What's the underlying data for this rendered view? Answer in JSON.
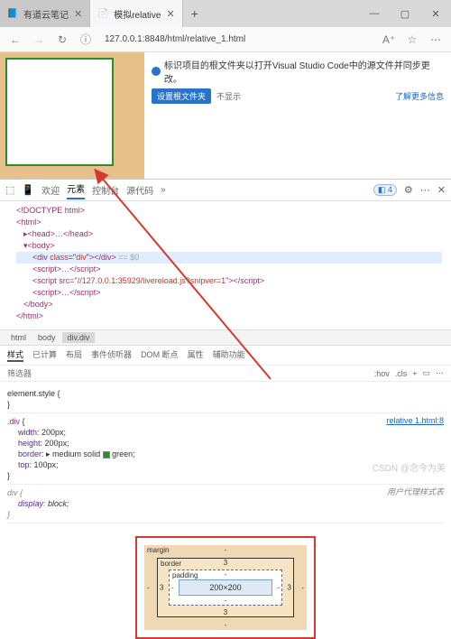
{
  "tabs": {
    "inactive_icon": "📘",
    "inactive_label": "有道云笔记",
    "active_icon": "📄",
    "active_label": "模拟relative",
    "new": "+"
  },
  "window": {
    "min": "—",
    "max": "▢",
    "close": "✕"
  },
  "nav": {
    "back": "←",
    "fwd": "→",
    "reload": "↻",
    "info": "ⓘ"
  },
  "url": "127.0.0.1:8848/html/relative_1.html",
  "toolbar_right": {
    "reader": "A⁺",
    "star": "☆",
    "menu": "⋯"
  },
  "notice": {
    "line1": "标识项目的根文件夹以打开Visual Studio Code中的源文件并同步更改。",
    "btn": "设置根文件夹",
    "skip": "不显示",
    "more": "了解更多信息"
  },
  "devtabs": {
    "pick": "⬚",
    "device": "📱",
    "t1": "欢迎",
    "t2": "元素",
    "t3": "控制台",
    "t4": "源代码",
    "more": "»",
    "issue_icon": "◧",
    "issue_n": "4",
    "gear": "⚙",
    "dots": "⋯",
    "x": "✕"
  },
  "source": {
    "l1": "<!DOCTYPE html>",
    "l2o": "<html>",
    "l3": "▸<head>…</head>",
    "l4": "▾<body>",
    "l5": "<div class=\"div\"></div>",
    "l5c": " == $0",
    "l6": "<script>…</script>",
    "l7a": "<script src=\"",
    "l7b": "//127.0.0.1:35929/livereload.js?snipver=1",
    "l7c": "\"></script>",
    "l8": "<script>…</script>",
    "l9": "</body>",
    "l10": "</html>"
  },
  "crumbs": {
    "c1": "html",
    "c2": "body",
    "c3": "div.div"
  },
  "stabs": {
    "t1": "样式",
    "t2": "已计算",
    "t3": "布局",
    "t4": "事件侦听器",
    "t5": "DOM 断点",
    "t6": "属性",
    "t7": "辅助功能"
  },
  "filter": {
    "ph": "筛选器",
    "hov": ":hov",
    "cls": ".cls",
    "plus": "+",
    "io": "▭",
    "dots": "⋯"
  },
  "rules": {
    "es": "element.style {",
    "close": "}",
    "link": "relative 1.html:8",
    "sel": "div {",
    "p1n": "width",
    "p1v": "200px;",
    "p2n": "height",
    "p2v": "200px;",
    "p3n": "border",
    "p3v": "▸ medium solid ",
    "p3c": "green;",
    "p4n": "top",
    "p4v": "100px;",
    "ua_lbl": "用户代理样式表",
    "ua_sel": "div {",
    "ua_p": "display",
    "ua_v": "block;"
  },
  "box": {
    "margin": "margin",
    "border": "border",
    "padding": "padding",
    "content": "200×200",
    "m": "-",
    "b": "3",
    "p": "-"
  },
  "watermark": "CSDN @念今为美"
}
